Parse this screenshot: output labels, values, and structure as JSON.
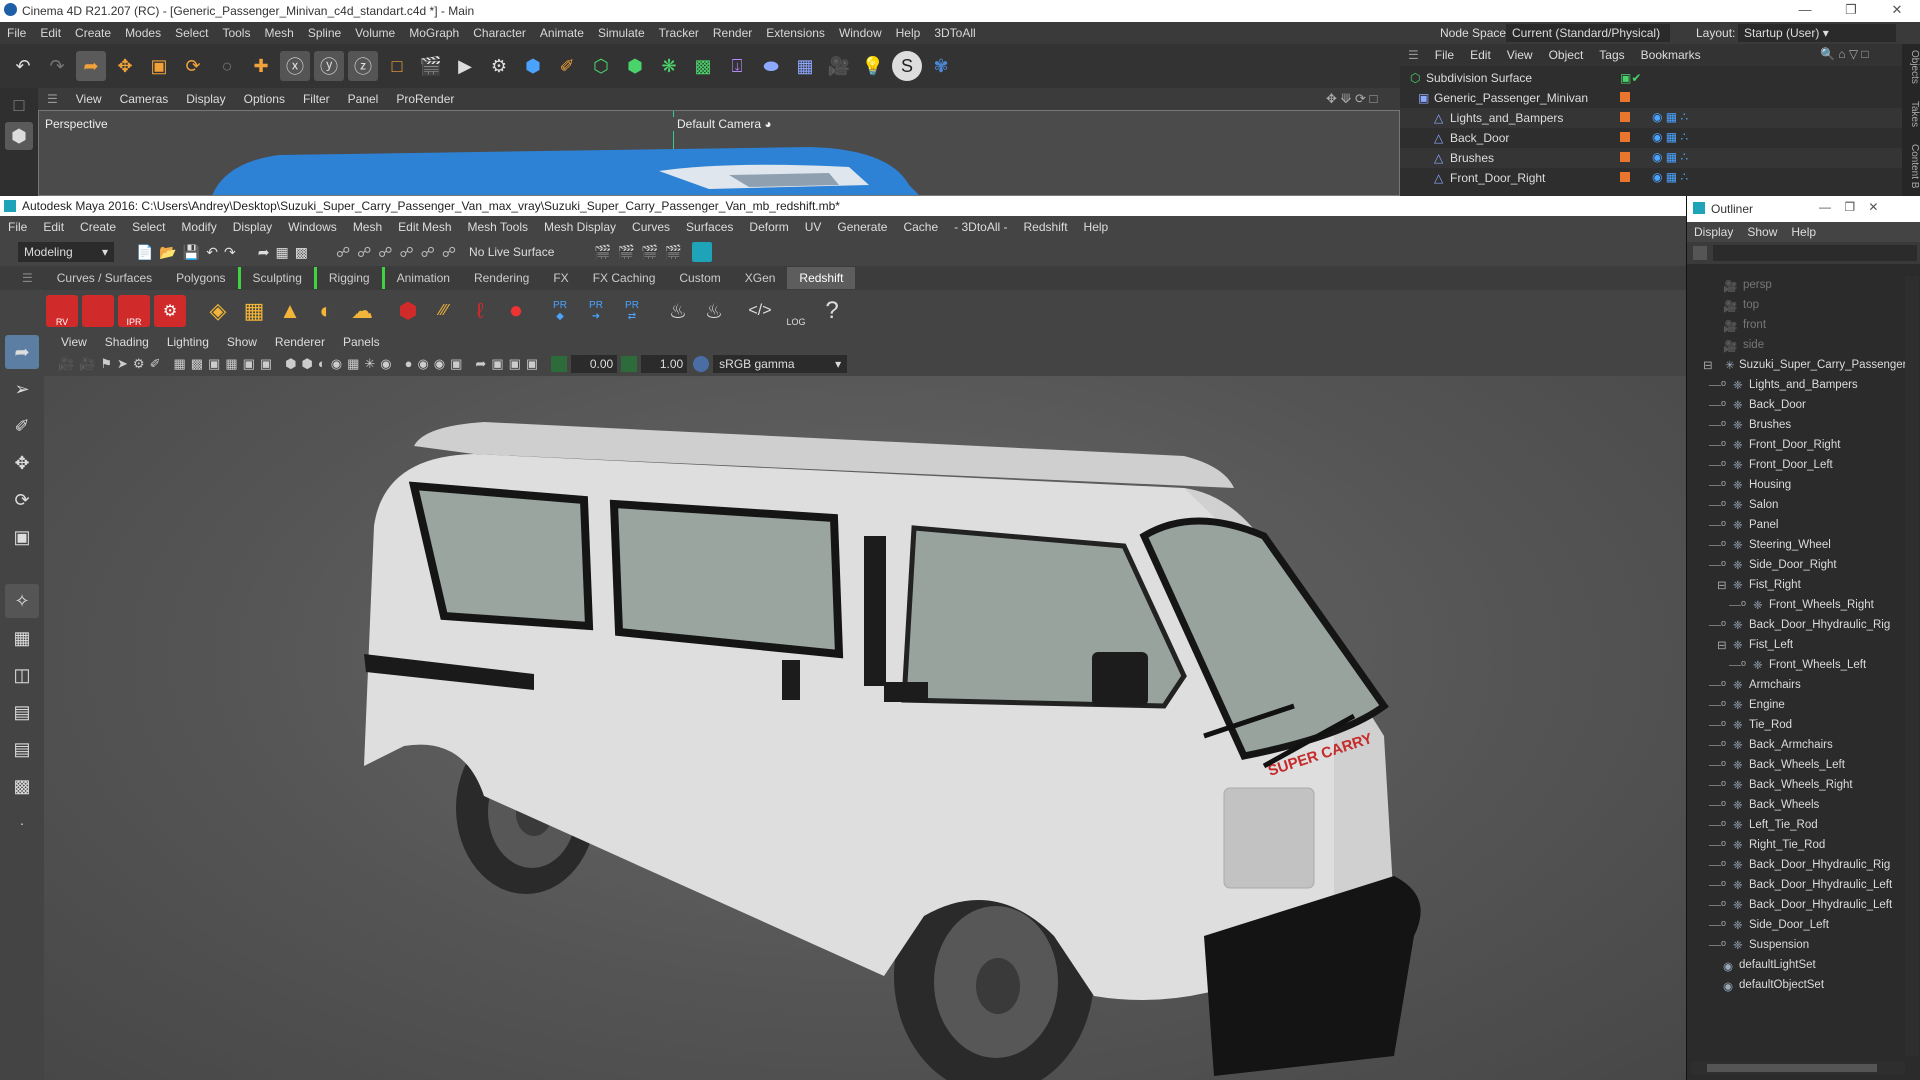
{
  "c4d": {
    "title": "Cinema 4D R21.207 (RC) - [Generic_Passenger_Minivan_c4d_standart.c4d *] - Main",
    "menu": [
      "File",
      "Edit",
      "Create",
      "Modes",
      "Select",
      "Tools",
      "Mesh",
      "Spline",
      "Volume",
      "MoGraph",
      "Character",
      "Animate",
      "Simulate",
      "Tracker",
      "Render",
      "Extensions",
      "Window",
      "Help",
      "3DToAll"
    ],
    "node_space_label": "Node Space:",
    "node_space_value": "Current (Standard/Physical)",
    "layout_label": "Layout:",
    "layout_value": "Startup (User)",
    "view_menu": [
      "View",
      "Cameras",
      "Display",
      "Options",
      "Filter",
      "Panel",
      "ProRender"
    ],
    "viewport_label": "Perspective",
    "camera_label": "Default Camera",
    "obj_menu": [
      "File",
      "Edit",
      "View",
      "Object",
      "Tags",
      "Bookmarks"
    ],
    "objects": [
      "Subdivision Surface",
      "Generic_Passenger_Minivan",
      "Lights_and_Bampers",
      "Back_Door",
      "Brushes",
      "Front_Door_Right"
    ],
    "side_tabs": [
      "Objects",
      "Takes",
      "Content B"
    ]
  },
  "maya": {
    "title": "Autodesk Maya 2016: C:\\Users\\Andrey\\Desktop\\Suzuki_Super_Carry_Passenger_Van_max_vray\\Suzuki_Super_Carry_Passenger_Van_mb_redshift.mb*",
    "menu": [
      "File",
      "Edit",
      "Create",
      "Select",
      "Modify",
      "Display",
      "Windows",
      "Mesh",
      "Edit Mesh",
      "Mesh Tools",
      "Mesh Display",
      "Curves",
      "Surfaces",
      "Deform",
      "UV",
      "Generate",
      "Cache",
      "- 3DtoAll -",
      "Redshift",
      "Help"
    ],
    "mode": "Modeling",
    "live_surface": "No Live Surface",
    "shelf_tabs": [
      "Curves / Surfaces",
      "Polygons",
      "Sculpting",
      "Rigging",
      "Animation",
      "Rendering",
      "FX",
      "FX Caching",
      "Custom",
      "XGen",
      "Redshift"
    ],
    "active_shelf_tab": "Redshift",
    "shelf_labels": {
      "rv": "RV",
      "ipr": "IPR",
      "pr": "PR",
      "log": "LOG",
      "help": "?"
    },
    "panel_menu": [
      "View",
      "Shading",
      "Lighting",
      "Show",
      "Renderer",
      "Panels"
    ],
    "exposure": "0.00",
    "gamma": "1.00",
    "color_space": "sRGB gamma",
    "van_badge": "SUPER CARRY"
  },
  "outliner": {
    "title": "Outliner",
    "menu": [
      "Display",
      "Show",
      "Help"
    ],
    "cameras": [
      "persp",
      "top",
      "front",
      "side"
    ],
    "root": "Suzuki_Super_Carry_Passenger",
    "items": [
      {
        "label": "Lights_and_Bampers",
        "depth": 1
      },
      {
        "label": "Back_Door",
        "depth": 1
      },
      {
        "label": "Brushes",
        "depth": 1
      },
      {
        "label": "Front_Door_Right",
        "depth": 1
      },
      {
        "label": "Front_Door_Left",
        "depth": 1
      },
      {
        "label": "Housing",
        "depth": 1
      },
      {
        "label": "Salon",
        "depth": 1
      },
      {
        "label": "Panel",
        "depth": 1
      },
      {
        "label": "Steering_Wheel",
        "depth": 1
      },
      {
        "label": "Side_Door_Right",
        "depth": 1
      },
      {
        "label": "Fist_Right",
        "depth": 1,
        "expanded": true
      },
      {
        "label": "Front_Wheels_Right",
        "depth": 2
      },
      {
        "label": "Back_Door_Hhydraulic_Rig",
        "depth": 1
      },
      {
        "label": "Fist_Left",
        "depth": 1,
        "expanded": true
      },
      {
        "label": "Front_Wheels_Left",
        "depth": 2
      },
      {
        "label": "Armchairs",
        "depth": 1
      },
      {
        "label": "Engine",
        "depth": 1
      },
      {
        "label": "Tie_Rod",
        "depth": 1
      },
      {
        "label": "Back_Armchairs",
        "depth": 1
      },
      {
        "label": "Back_Wheels_Left",
        "depth": 1
      },
      {
        "label": "Back_Wheels_Right",
        "depth": 1
      },
      {
        "label": "Back_Wheels",
        "depth": 1
      },
      {
        "label": "Left_Tie_Rod",
        "depth": 1
      },
      {
        "label": "Right_Tie_Rod",
        "depth": 1
      },
      {
        "label": "Back_Door_Hhydraulic_Rig",
        "depth": 1
      },
      {
        "label": "Back_Door_Hhydraulic_Left",
        "depth": 1
      },
      {
        "label": "Back_Door_Hhydraulic_Left",
        "depth": 1
      },
      {
        "label": "Side_Door_Left",
        "depth": 1
      },
      {
        "label": "Suspension",
        "depth": 1
      }
    ],
    "sets": [
      "defaultLightSet",
      "defaultObjectSet"
    ]
  },
  "colors": {
    "accent_blue": "#2f8fd8",
    "maya_bg": "#444444",
    "c4d_orange": "#e8762c",
    "van_white": "#e4e4e4"
  }
}
